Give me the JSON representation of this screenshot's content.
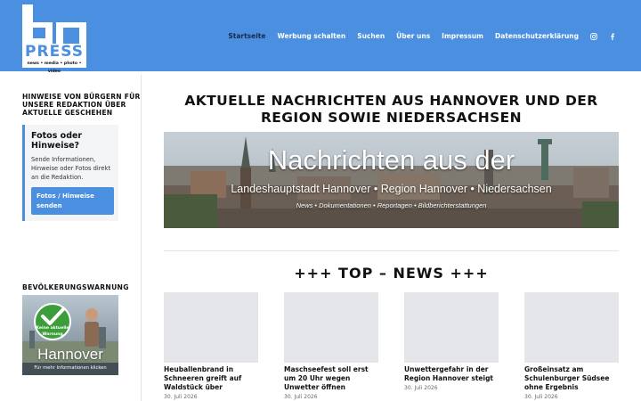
{
  "header": {
    "logo": {
      "word": "PRESS",
      "tagline": "news • media • photo • video"
    },
    "nav": [
      {
        "label": "Startseite"
      },
      {
        "label": "Werbung schalten"
      },
      {
        "label": "Suchen"
      },
      {
        "label": "Über uns"
      },
      {
        "label": "Impressum"
      },
      {
        "label": "Datenschutzerklärung"
      }
    ],
    "social": [
      "instagram-icon",
      "facebook-icon"
    ]
  },
  "sidebar": {
    "tips_heading": "HINWEISE VON BÜRGERN FÜR UNSERE REDAKTION ÜBER AKTUELLE GESCHEHEN",
    "tip_box": {
      "title": "Fotos oder Hinweise?",
      "text": "Sende Informationen, Hinweise oder Fotos direkt an die Redaktion.",
      "button": " Fotos / Hinweise senden"
    },
    "warning_heading": "BEVÖLKERUNGSWARNUNG",
    "warning_badge": {
      "line1": "Keine aktuelle",
      "line2": "Warnung"
    },
    "warning_city": "Hannover",
    "warning_footer": "Für mehr Informationen klicken"
  },
  "main": {
    "title": "AKTUELLE NACHRICHTEN AUS HANNOVER UND DER REGION SOWIE NIEDERSACHSEN",
    "banner": {
      "line1": "Nachrichten aus der",
      "line2": "Landeshauptstadt Hannover • Region Hannover • Niedersachsen",
      "line3": "News • Dokumentationen • Reportagen • Bildberichterstattungen"
    },
    "section_title": "+++ TOP – NEWS +++",
    "cards": [
      {
        "title": "Heuballenbrand in Schneeren greift auf Waldstück über",
        "date": "30. Juli 2026"
      },
      {
        "title": "Maschseefest soll erst um 20 Uhr wegen Unwetter öffnen",
        "date": "30. Juli 2026"
      },
      {
        "title": "Unwettergefahr in der Region Hannover steigt",
        "date": "30. Juli 2026"
      },
      {
        "title": "Großeinsatz am Schulenburger Südsee ohne Ergebnis",
        "date": "30. Juli 2026"
      }
    ]
  },
  "colors": {
    "header_bg": "#4a8fe0",
    "accent": "#4a8fe0"
  }
}
